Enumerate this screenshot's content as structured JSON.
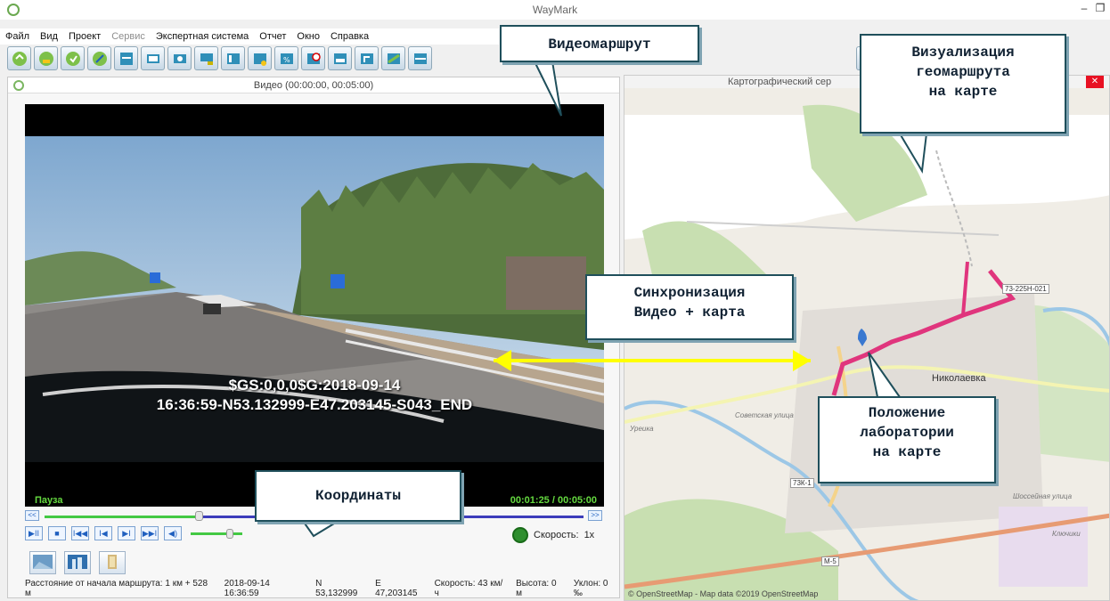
{
  "window": {
    "title": "WayMark",
    "controls": [
      "–",
      "❐",
      "✕"
    ]
  },
  "menu": [
    "Файл",
    "Вид",
    "Проект",
    "Сервис",
    "Экспертная система",
    "Отчет",
    "Окно",
    "Справка"
  ],
  "video": {
    "title": "Видео (00:00:00, 00:05:00)",
    "overlay_line1": "$GS:0,0,0$G:2018-09-14",
    "overlay_line2": "16:36:59-N53.132999-E47.203145-S043_END",
    "status_left": "Пауза",
    "status_right": "00:01:25 / 00:05:00",
    "playback_fraction": 0.283,
    "speed_label": "Скорость:",
    "speed_value": "1x",
    "seek_back": "<<",
    "seek_forward": ">>",
    "buttons": [
      "▶II",
      "■",
      "I◀◀",
      "I◀",
      "▶I",
      "▶▶I",
      "◀)"
    ]
  },
  "status_bar": {
    "distance": "Расстояние от начала маршрута: 1 км + 528 м",
    "datetime": "2018-09-14 16:36:59",
    "lat": "N 53,132999",
    "lon": "E 47,203145",
    "speed": "Скорость: 43 км/ч",
    "altitude": "Высота: 0 м",
    "slope": "Уклон: 0 ‰"
  },
  "map": {
    "title": "Картографический сер",
    "close": "✕",
    "attribution": "© OpenStreetMap - Map data ©2019 OpenStreetMap",
    "town": "Николаевка",
    "road1": "73-225Н-021",
    "road2": "73К-1",
    "road3": "М-5",
    "street1": "Советская улица",
    "street2": "Шоссейная улица",
    "place": "Ключики",
    "river": "Уреика"
  },
  "callouts": {
    "video_route": "Видеомаршрут",
    "map_visual": [
      "Визуализация",
      "геомаршрута",
      "на карте"
    ],
    "sync": [
      "Синхронизация",
      "Видео + карта"
    ],
    "coords": "Координаты",
    "lab_pos": [
      "Положение",
      "лаборатории",
      "на карте"
    ]
  },
  "colors": {
    "accent_green": "#64d83f",
    "route_pink": "#e0357d",
    "arrow_yellow": "#ffff00"
  }
}
